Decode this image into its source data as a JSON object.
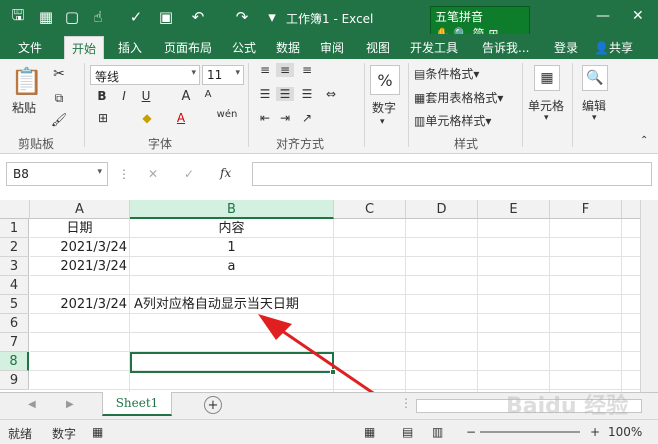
{
  "window": {
    "title": "工作簿1 - Excel",
    "ime": {
      "line1": "五笔拼音",
      "line2": "简"
    }
  },
  "quick_access": {
    "icons": [
      "save-icon",
      "grid-icon",
      "touch-icon",
      "check-icon",
      "format-painter-icon",
      "undo-icon",
      "redo-icon",
      "customize-icon"
    ]
  },
  "tabs": [
    "文件",
    "开始",
    "插入",
    "页面布局",
    "公式",
    "数据",
    "审阅",
    "视图",
    "开发工具"
  ],
  "tell_me": "告诉我...",
  "signin": "登录",
  "share": "共享",
  "ribbon": {
    "clipboard": {
      "label": "剪贴板",
      "paste": "粘贴"
    },
    "font": {
      "label": "字体",
      "name": "等线",
      "size": "11",
      "bold": "B",
      "italic": "I",
      "underline": "U",
      "grow": "A",
      "shrink": "A",
      "wen": "wén"
    },
    "alignment": {
      "label": "对齐方式"
    },
    "number": {
      "label": "数字",
      "btn": "数字",
      "percent": "%"
    },
    "styles": {
      "label": "样式",
      "conditional": "条件格式",
      "table": "套用表格格式",
      "cell": "单元格样式"
    },
    "cells": {
      "label": "单元格"
    },
    "editing": {
      "label": "编辑"
    }
  },
  "formula_bar": {
    "name_box": "B8",
    "fx": "fx",
    "value": ""
  },
  "columns": [
    "A",
    "B",
    "C",
    "D",
    "E",
    "F"
  ],
  "rows": [
    "1",
    "2",
    "3",
    "4",
    "5",
    "6",
    "7",
    "8",
    "9"
  ],
  "cells": {
    "A1": "日期",
    "B1": "内容",
    "A2": "2021/3/24",
    "B2": "1",
    "A3": "2021/3/24",
    "B3": "a",
    "A5": "2021/3/24",
    "B5": "A列对应格自动显示当天日期"
  },
  "active_cell": "B8",
  "sheets": [
    "Sheet1"
  ],
  "status": {
    "mode": "就绪",
    "num": "数字",
    "zoom": "100%"
  },
  "watermark": "Baidu 经验",
  "colors": {
    "accent": "#217346",
    "arrow": "#e02020"
  }
}
